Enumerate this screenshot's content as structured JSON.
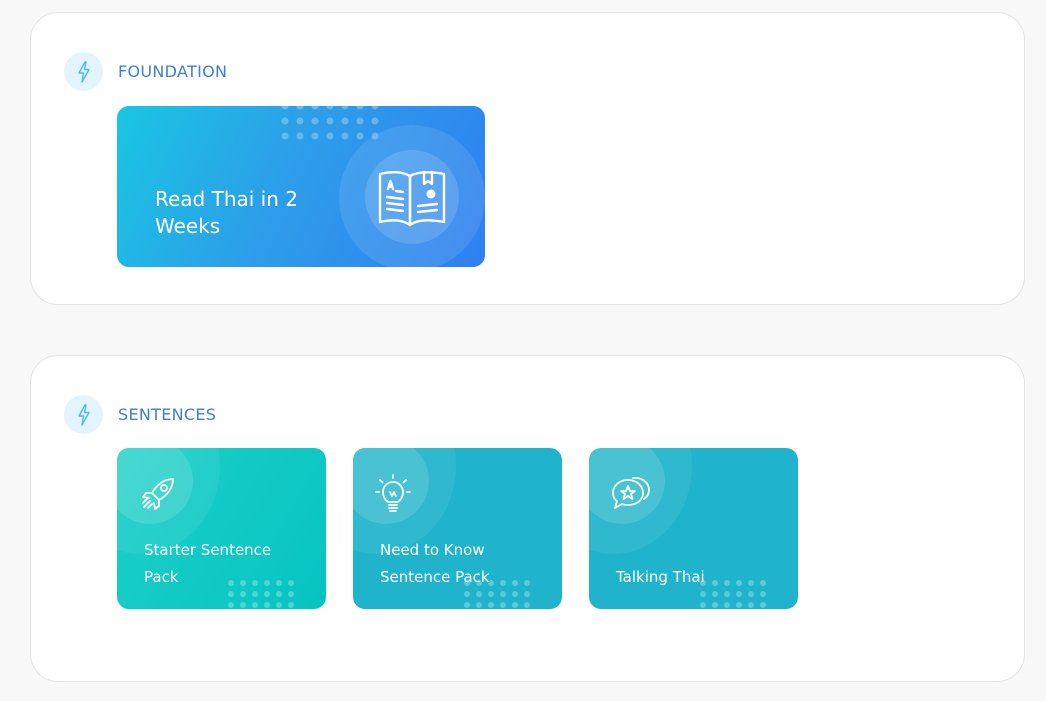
{
  "sections": [
    {
      "title": "FOUNDATION",
      "icon": "lightning-bolt-icon",
      "cards": [
        {
          "label": "Read Thai in 2 Weeks",
          "icon": "open-book-icon"
        }
      ]
    },
    {
      "title": "SENTENCES",
      "icon": "lightning-bolt-icon",
      "cards": [
        {
          "label": "Starter Sentence Pack",
          "icon": "rocket-icon"
        },
        {
          "label": "Need to Know Sentence Pack",
          "icon": "lightbulb-icon"
        },
        {
          "label": "Talking Thai",
          "icon": "speech-bubbles-star-icon"
        }
      ]
    }
  ],
  "colors": {
    "page_bg": "#f8f8f8",
    "section_title": "#3d7fd6",
    "bolt_bg": "#e3f4fc",
    "bolt_stroke": "#4fb9ea",
    "foundation_card_start": "#19c6e2",
    "foundation_card_end": "#2f7ff0",
    "starter_card": "#0cc8c4",
    "sentence_card": "#1fb4cb"
  }
}
